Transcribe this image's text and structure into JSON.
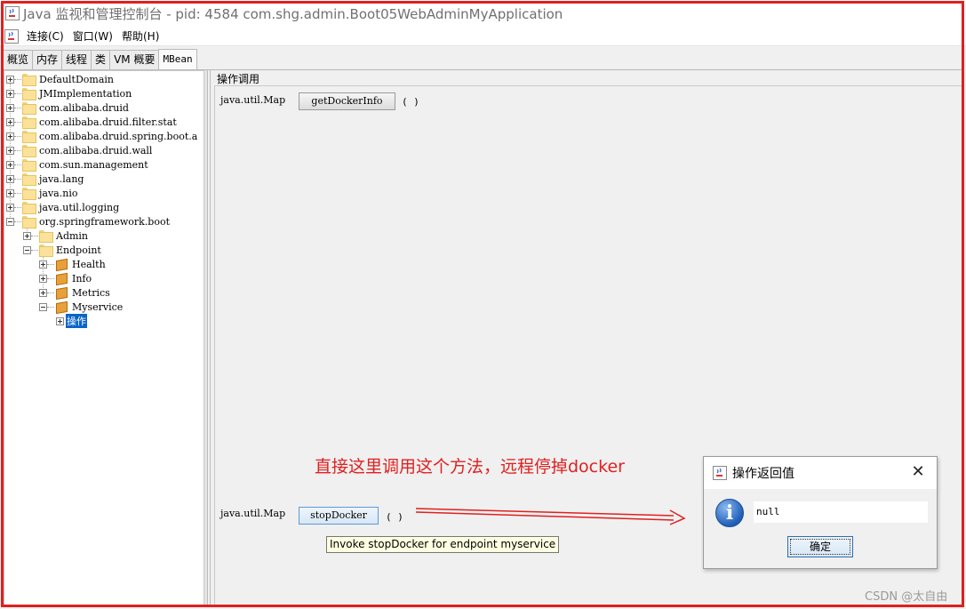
{
  "window": {
    "title": "Java 监视和管理控制台 - pid: 4584 com.shg.admin.Boot05WebAdminMyApplication"
  },
  "menu": [
    "连接(C)",
    "窗口(W)",
    "帮助(H)"
  ],
  "tabs": [
    "概览",
    "内存",
    "线程",
    "类",
    "VM 概要",
    "MBean"
  ],
  "active_tab": "MBean",
  "tree": {
    "items": [
      "DefaultDomain",
      "JMImplementation",
      "com.alibaba.druid",
      "com.alibaba.druid.filter.stat",
      "com.alibaba.druid.spring.boot.a",
      "com.alibaba.druid.wall",
      "com.sun.management",
      "java.lang",
      "java.nio",
      "java.util.logging",
      "org.springframework.boot",
      "Admin",
      "Endpoint",
      "Health",
      "Info",
      "Metrics",
      "Myservice",
      "操作"
    ],
    "selected": "操作"
  },
  "operations": {
    "title": "操作调用",
    "list": [
      {
        "return_type": "java.util.Map",
        "name": "getDockerInfo",
        "params": "( )"
      },
      {
        "return_type": "java.util.Map",
        "name": "stopDocker",
        "params": "( )"
      }
    ],
    "tooltip": "Invoke stopDocker for endpoint myservice"
  },
  "annotation": "直接这里调用这个方法，远程停掉docker",
  "dialog": {
    "title": "操作返回值",
    "value": "null",
    "ok": "确定",
    "close": "✕"
  },
  "watermark": "CSDN @太自由",
  "colors": {
    "highlight_frame": "#e02020",
    "annotation": "#e02020",
    "selection": "#0a64c8",
    "tooltip_bg": "#ffffe1"
  }
}
